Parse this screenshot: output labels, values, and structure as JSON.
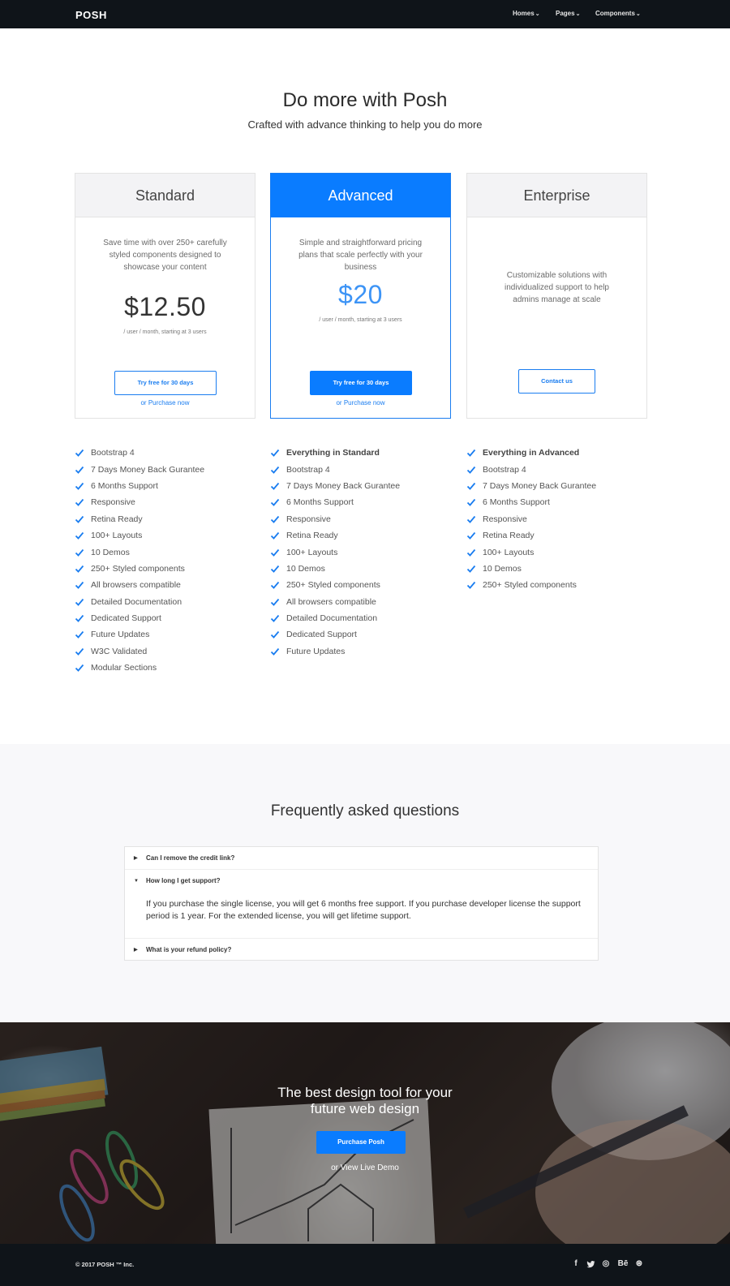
{
  "nav": {
    "brand": "POSH",
    "items": [
      {
        "label": "Homes"
      },
      {
        "label": "Pages"
      },
      {
        "label": "Components"
      }
    ],
    "chevron": "⌄"
  },
  "hero": {
    "title": "Do more with Posh",
    "subtitle": "Crafted with advance thinking to help you do more"
  },
  "plans": [
    {
      "name": "Standard",
      "description": "Save time with over 250+ carefully styled components designed to showcase your content",
      "price": "$12.50",
      "price_note": "/ user / month, starting at 3 users",
      "button": "Try free for 30 days",
      "link": "or Purchase now"
    },
    {
      "name": "Advanced",
      "description": "Simple and straightforward pricing plans that scale perfectly with your business",
      "price": "$20",
      "price_note": "/ user / month, starting at 3 users",
      "button": "Try free for 30 days",
      "link": "or Purchase now"
    },
    {
      "name": "Enterprise",
      "description": "Customizable solutions with individualized support to help admins manage at scale",
      "button": "Contact us"
    }
  ],
  "features": {
    "standard": [
      "Bootstrap 4",
      "7 Days Money Back Gurantee",
      "6 Months Support",
      "Responsive",
      "Retina Ready",
      "100+ Layouts",
      "10 Demos",
      "250+ Styled components",
      "All browsers compatible",
      "Detailed Documentation",
      "Dedicated Support",
      "Future Updates",
      "W3C Validated",
      "Modular Sections"
    ],
    "advanced": [
      "Everything in Standard",
      "Bootstrap 4",
      "7 Days Money Back Gurantee",
      "6 Months Support",
      "Responsive",
      "Retina Ready",
      "100+ Layouts",
      "10 Demos",
      "250+ Styled components",
      "All browsers compatible",
      "Detailed Documentation",
      "Dedicated Support",
      "Future Updates"
    ],
    "enterprise": [
      "Everything in Advanced",
      "Bootstrap 4",
      "7 Days Money Back Gurantee",
      "6 Months Support",
      "Responsive",
      "Retina Ready",
      "100+ Layouts",
      "10 Demos",
      "250+ Styled components"
    ]
  },
  "faq": {
    "title": "Frequently asked questions",
    "items": [
      {
        "question": "Can I remove the credit link?",
        "expanded": false
      },
      {
        "question": "How long I get support?",
        "expanded": true,
        "answer": "If you purchase the single license, you will get 6 months free support. If you purchase developer license the support period is 1 year. For the extended license, you will get lifetime support."
      },
      {
        "question": "What is your refund policy?",
        "expanded": false
      }
    ]
  },
  "cta": {
    "title_line1": "The best design tool for your",
    "title_line2": "future web design",
    "button": "Purchase Posh",
    "link": "or View Live Demo"
  },
  "footer": {
    "copyright": "© 2017 POSH ™ Inc.",
    "social": [
      {
        "icon": "facebook-icon",
        "glyph": "f"
      },
      {
        "icon": "twitter-icon",
        "glyph": "t"
      },
      {
        "icon": "instagram-icon",
        "glyph": "◎"
      },
      {
        "icon": "behance-icon",
        "glyph": "Bē"
      },
      {
        "icon": "dribbble-icon",
        "glyph": "⊛"
      }
    ]
  },
  "colors": {
    "accent": "#0a7cff",
    "nav_bg": "#0f1419",
    "check": "#1a7df0"
  }
}
